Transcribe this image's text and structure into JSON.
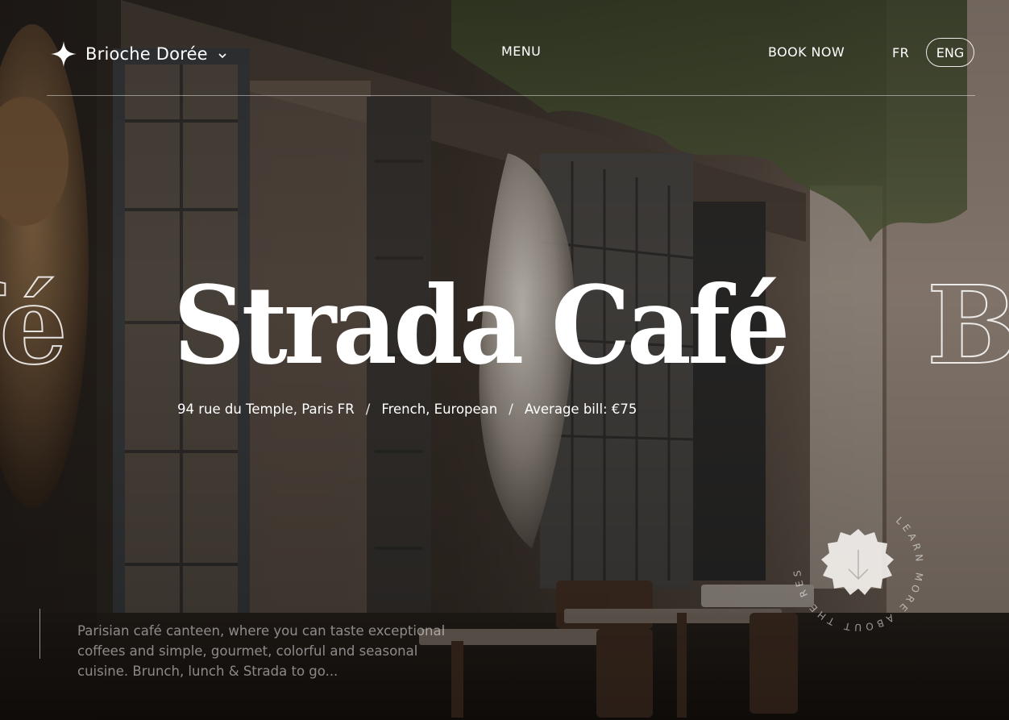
{
  "brand": {
    "name": "Brioche Dorée",
    "icon": "sparkle-icon"
  },
  "nav": {
    "menu": "MENU",
    "book": "BOOK NOW"
  },
  "lang": {
    "fr": "FR",
    "eng": "ENG",
    "active": "ENG"
  },
  "hero": {
    "title": "Strada Café",
    "ghost_left": "fé",
    "ghost_right": "B",
    "address": "94 rue du Temple, Paris FR",
    "cuisine": "French, European",
    "bill": "Average bill: €75",
    "separator": "/"
  },
  "description": {
    "text": "Parisian café canteen, where you can taste exceptional coffees and simple, gourmet, colorful and seasonal cuisine. Brunch, lunch & Strada to go..."
  },
  "learn_more": {
    "ring_text": "LEARN MORE ABOUT THE RESTAURANT",
    "icon": "arrow-down-icon"
  },
  "colors": {
    "text": "#ffffff",
    "overlay": "#000000",
    "badge": "#f2efec"
  }
}
